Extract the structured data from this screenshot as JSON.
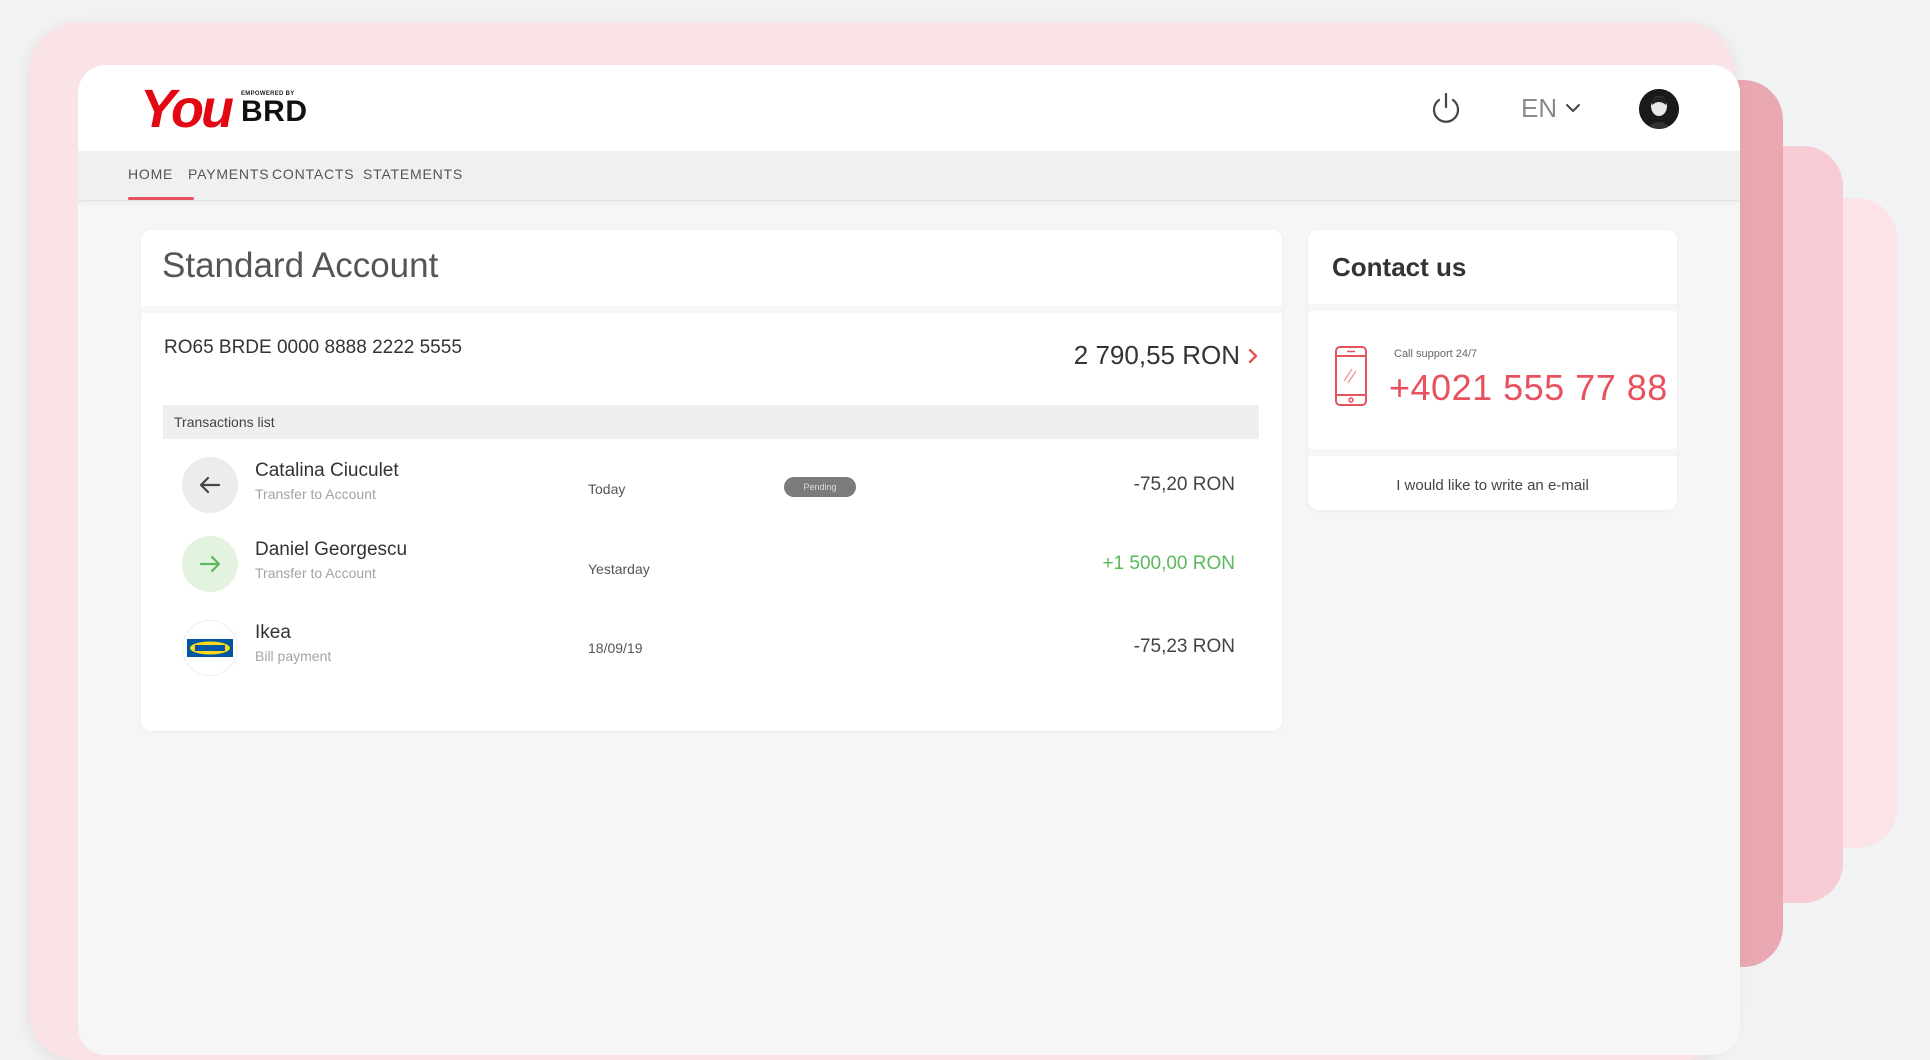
{
  "logo": {
    "you": "You",
    "tagline": "EMPOWERED BY",
    "brand": "BRD"
  },
  "header": {
    "language": "EN"
  },
  "nav": {
    "items": [
      {
        "label": "HOME",
        "active": true
      },
      {
        "label": "PAYMENTS",
        "active": false
      },
      {
        "label": "CONTACTS",
        "active": false
      },
      {
        "label": "STATEMENTS",
        "active": false
      }
    ]
  },
  "account": {
    "title": "Standard Account",
    "iban": "RO65 BRDE 0000 8888 2222 5555",
    "balance": "2 790,55 RON",
    "transactions_label": "Transactions list",
    "transactions": [
      {
        "name": "Catalina Ciuculet",
        "type": "Transfer to Account",
        "date": "Today",
        "status": "Pending",
        "amount": "-75,20 RON",
        "icon": "arrow-left-icon"
      },
      {
        "name": "Daniel Georgescu",
        "type": "Transfer to Account",
        "date": "Yestarday",
        "status": "",
        "amount": "+1 500,00 RON",
        "icon": "arrow-right-icon"
      },
      {
        "name": "Ikea",
        "type": "Bill payment",
        "date": "18/09/19",
        "status": "",
        "amount": "-75,23 RON",
        "icon": "ikea-logo-icon"
      }
    ]
  },
  "contact": {
    "title": "Contact us",
    "support_label": "Call support 24/7",
    "phone": "+4021 555 77 88",
    "email_link": "I would like to write an e-mail"
  },
  "colors": {
    "accent": "#e8525f",
    "brand_red": "#e30613",
    "positive": "#5cb85c"
  }
}
